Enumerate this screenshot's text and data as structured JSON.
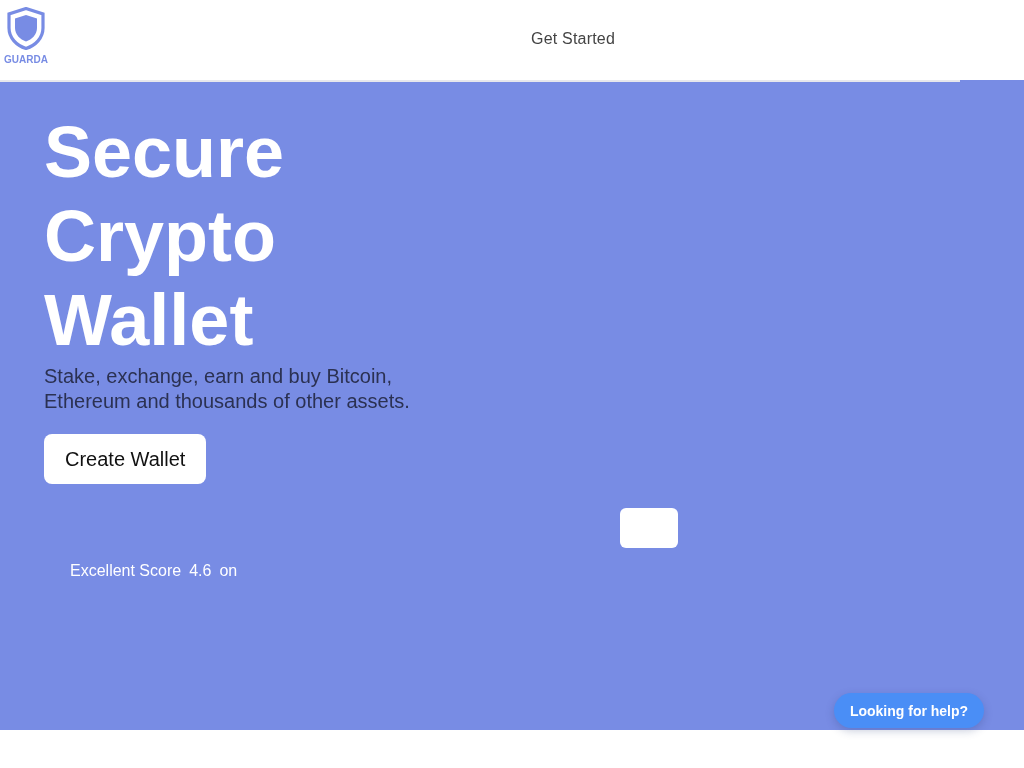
{
  "header": {
    "logo": {
      "text": "GUARDA"
    },
    "nav": [
      {
        "label": "Get Started"
      }
    ]
  },
  "hero": {
    "title": "Secure Crypto Wallet",
    "subtitle": "Stake, exchange, earn and buy Bitcoin, Ethereum and thousands of other assets.",
    "cta": {
      "label": "Create Wallet"
    },
    "rating": {
      "label": "Excellent Score",
      "score": "4.6",
      "suffix": "on"
    }
  },
  "help_button": {
    "label": "Looking for help?"
  }
}
